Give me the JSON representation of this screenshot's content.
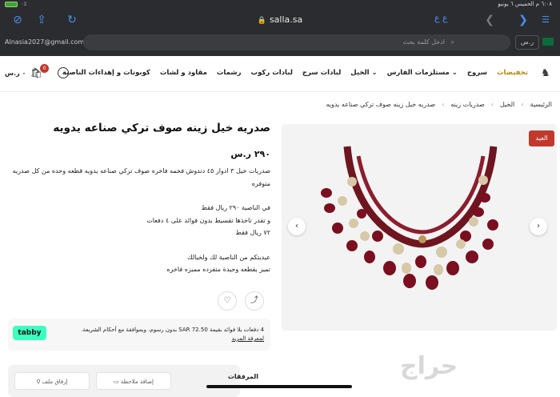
{
  "status": {
    "time": "٦:٠٨ م  الخميس ٦ يونيو",
    "battery": "٠٪"
  },
  "browser": {
    "url": "salla.sa",
    "aa_label": "ع ع",
    "email": "Alnasia2027@gmail.com",
    "search_placeholder": "ادخل كلمة بحث",
    "rs_label": "ر.س"
  },
  "nav": {
    "items": [
      "تخفيضات",
      "سروج",
      "مستلزمات الفارس",
      "الخيل",
      "لبادات سرج",
      "لبادات ركوب",
      "رشمات",
      "مقاود و لشات",
      "كوبونات و إهداءات الناصية"
    ],
    "cart_count": "0",
    "cart_total": "٠ ر.س"
  },
  "breadcrumb": [
    "الرئيسية",
    "الخيل",
    "صدريات زينه",
    "صدريه خيل زينه صوف تركي صناعه يدويه"
  ],
  "product": {
    "title": "صدريه خيل زينه صوف تركي صناعه يدويه",
    "price": "٢٩٠ ر.س",
    "desc1": "صدريات خيل ٣ ادوار ٤٥ دندوش فخمه فاخره صوف تركي صناعه يدويه قطعه وحده من كل صدريه متوفره",
    "desc2": "في الناصية ٢٩٠ ريال فقط",
    "desc3": "و تقدر تاخذها تقسيط بدون فوائد على ٤ دفعات",
    "desc4": "٧٢ ريال فقط",
    "desc5": "عيديتكم من الناصية لك ولخيالك",
    "desc6": "تميز بقطعه وحيدة متفرده مميزه فاخره",
    "sale_tag": "العيد"
  },
  "tabby": {
    "logo": "tabby",
    "text": "4 دفعات بلا فوائد بقيمة SAR 72.50 بدون رسوم، وبموافقة مع أحكام الشريعة.",
    "learn": "لمعرفة المزيد"
  },
  "attachments": {
    "label": "المرفقات",
    "note_btn": "إضافة ملاحظة",
    "file_btn": "إرفاق ملف"
  },
  "watermark": "حراج"
}
